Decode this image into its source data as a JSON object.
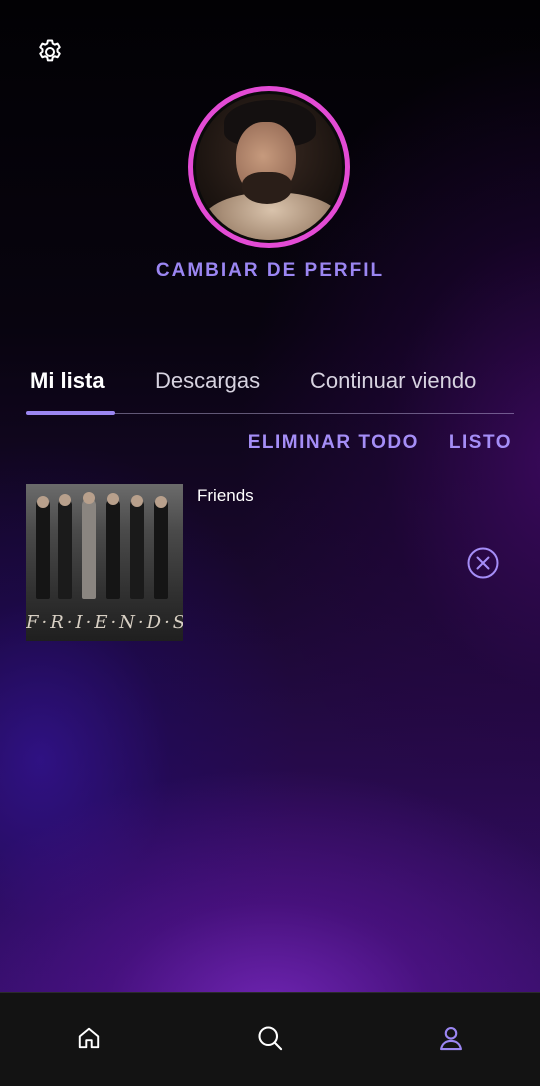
{
  "header": {
    "settings_icon": "gear-icon",
    "profile_switch_label": "CAMBIAR DE PERFIL"
  },
  "tabs": [
    {
      "label": "Mi lista",
      "active": true
    },
    {
      "label": "Descargas",
      "active": false
    },
    {
      "label": "Continuar viendo",
      "active": false
    }
  ],
  "list_actions": {
    "delete_all_label": "ELIMINAR TODO",
    "done_label": "LISTO"
  },
  "list_items": [
    {
      "title": "Friends",
      "poster_title": "F·R·I·E·N·D·S",
      "remove_icon": "close-circle-icon"
    }
  ],
  "bottom_nav": [
    {
      "icon": "home-icon",
      "active": false
    },
    {
      "icon": "search-icon",
      "active": false
    },
    {
      "icon": "profile-icon",
      "active": true
    }
  ],
  "colors": {
    "accent": "#9b86f2",
    "avatar_ring": "#e34bd5",
    "nav_background": "#131313"
  }
}
